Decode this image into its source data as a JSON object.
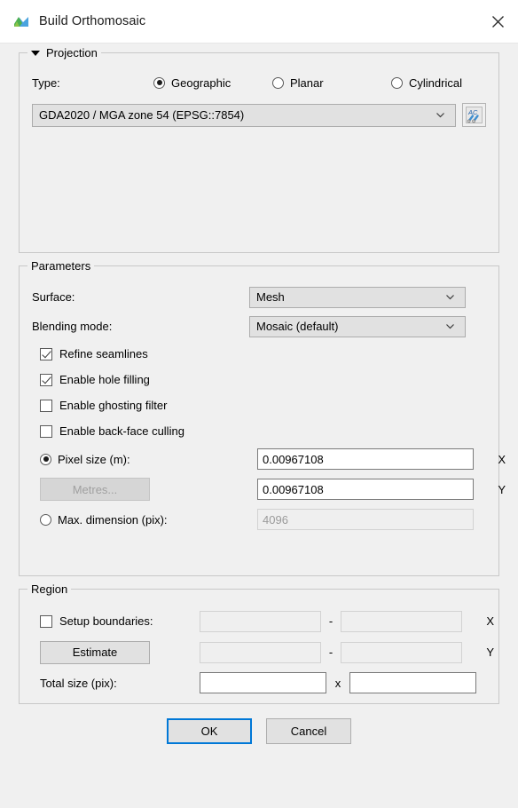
{
  "window": {
    "title": "Build Orthomosaic",
    "icon": "metashape-app-icon",
    "close_label": "close-icon"
  },
  "projection": {
    "group_title": "Projection",
    "expanded": true,
    "type_label": "Type:",
    "options": [
      {
        "label": "Geographic",
        "selected": true
      },
      {
        "label": "Planar",
        "selected": false
      },
      {
        "label": "Cylindrical",
        "selected": false
      }
    ],
    "crs_value": "GDA2020 / MGA zone 54 (EPSG::7854)",
    "crs_tool_icon": "crs-settings-icon"
  },
  "parameters": {
    "group_title": "Parameters",
    "surface_label": "Surface:",
    "surface_value": "Mesh",
    "blending_label": "Blending mode:",
    "blending_value": "Mosaic (default)",
    "checkboxes": [
      {
        "label": "Refine seamlines",
        "checked": true
      },
      {
        "label": "Enable hole filling",
        "checked": true
      },
      {
        "label": "Enable ghosting filter",
        "checked": false
      },
      {
        "label": "Enable back-face culling",
        "checked": false
      }
    ],
    "pixel_size_label": "Pixel size (m):",
    "pixel_size_selected": true,
    "pixel_size_x": "0.00967108",
    "pixel_size_y": "0.00967108",
    "metres_button": "Metres...",
    "metres_button_enabled": false,
    "max_dimension_label": "Max. dimension (pix):",
    "max_dimension_selected": false,
    "max_dimension_value": "4096",
    "axis_x": "X",
    "axis_y": "Y"
  },
  "region": {
    "group_title": "Region",
    "setup_boundaries_label": "Setup boundaries:",
    "setup_boundaries_checked": false,
    "estimate_button": "Estimate",
    "bounds_x_min": "",
    "bounds_x_max": "",
    "bounds_y_min": "",
    "bounds_y_max": "",
    "range_separator": "-",
    "axis_x": "X",
    "axis_y": "Y",
    "total_size_label": "Total size (pix):",
    "total_size_width": "",
    "total_size_height": "",
    "total_size_separator": "x"
  },
  "footer": {
    "ok_label": "OK",
    "cancel_label": "Cancel"
  },
  "colors": {
    "accent": "#0078d7",
    "dialog_bg": "#f0f0f0",
    "titlebar_bg": "#ffffff",
    "field_bg": "#ffffff",
    "combo_bg": "#e1e1e1",
    "disabled_text": "#9a9a9a"
  }
}
